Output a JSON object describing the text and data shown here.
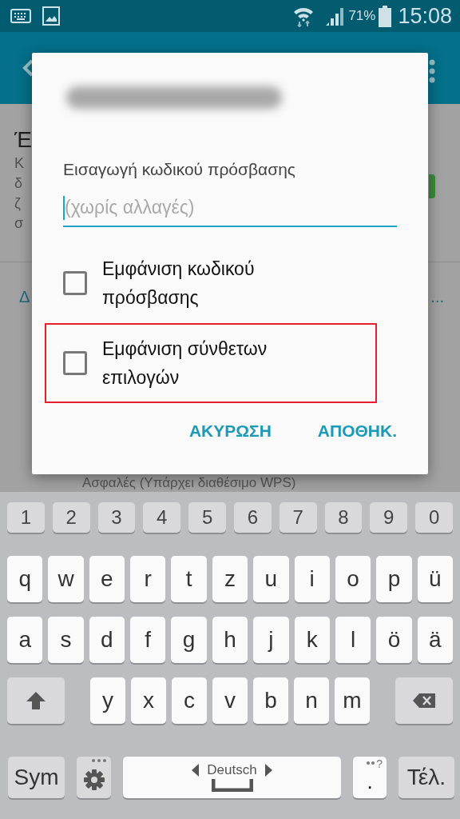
{
  "status_bar": {
    "battery": "71%",
    "time": "15:08"
  },
  "background": {
    "heading": "Έ",
    "description_lines": [
      "Κ",
      "δ",
      "ζ",
      "σ"
    ],
    "toggle_on": true,
    "section": "Δ",
    "section_more": "...",
    "network_status": "Ασφαλές (Υπάρχει διαθέσιμο WPS)"
  },
  "dialog": {
    "password_label": "Εισαγωγή κωδικού πρόσβασης",
    "password_placeholder": "(χωρίς αλλαγές)",
    "options": [
      {
        "label": "Εμφάνιση κωδικού πρόσβασης",
        "checked": false,
        "highlighted": false
      },
      {
        "label": "Εμφάνιση σύνθετων επιλογών",
        "checked": false,
        "highlighted": true
      }
    ],
    "buttons": [
      "ΑΚΥΡΩΣΗ",
      "ΑΠΟΘΗΚ."
    ]
  },
  "keyboard": {
    "number_row": [
      "1",
      "2",
      "3",
      "4",
      "5",
      "6",
      "7",
      "8",
      "9",
      "0"
    ],
    "letter_rows": [
      [
        "q",
        "w",
        "e",
        "r",
        "t",
        "z",
        "u",
        "i",
        "o",
        "p",
        "ü"
      ],
      [
        "a",
        "s",
        "d",
        "f",
        "g",
        "h",
        "j",
        "k",
        "l",
        "ö",
        "ä"
      ],
      [
        "y",
        "x",
        "c",
        "v",
        "b",
        "n",
        "m"
      ]
    ],
    "sym_key": "Sym",
    "language": "Deutsch",
    "period_key": ".",
    "period_hint": "?",
    "done_key": "Τέλ."
  }
}
